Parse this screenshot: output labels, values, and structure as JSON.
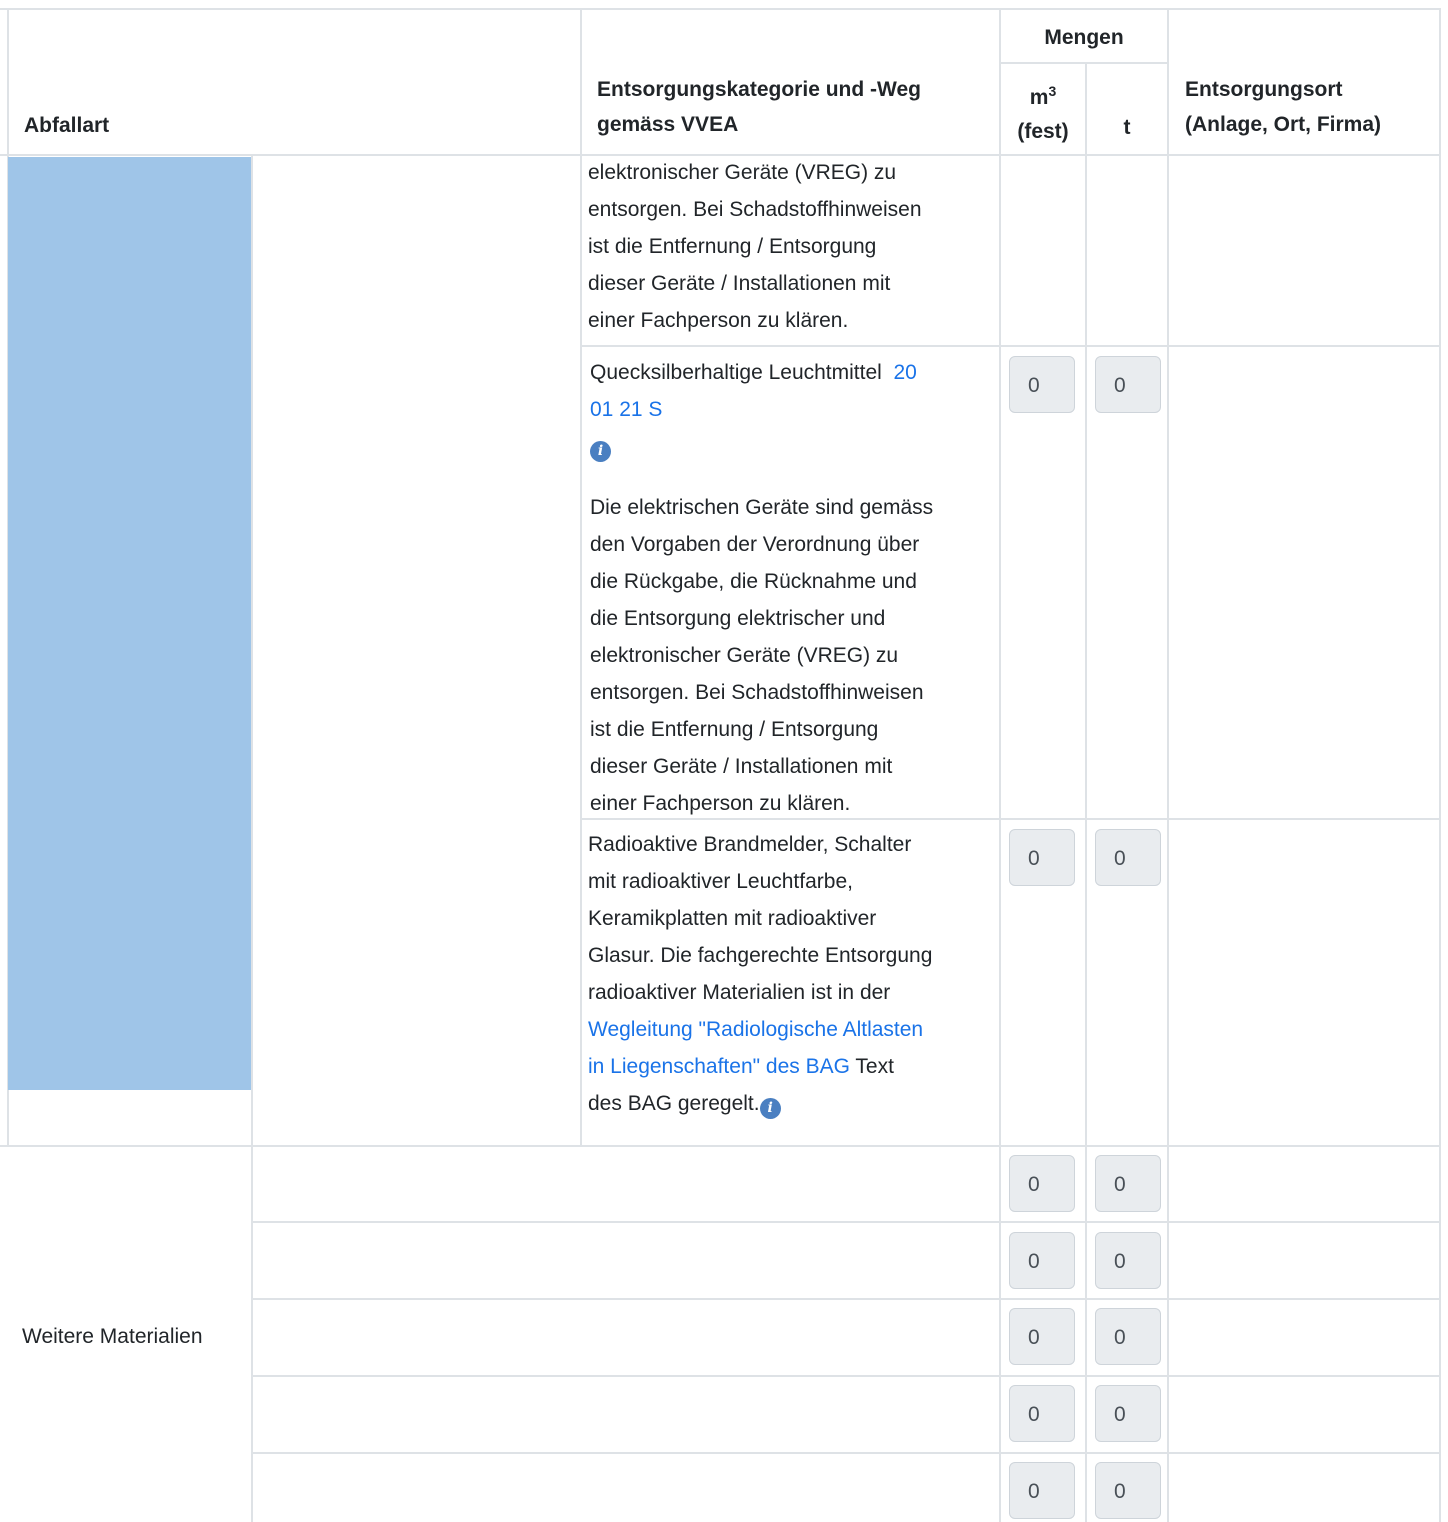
{
  "header": {
    "abfallart": "Abfallart",
    "kategorie_line1": "Entsorgungskategorie und -Weg",
    "kategorie_line2": "gemäss VVEA",
    "mengen": "Mengen",
    "m3_base": "m",
    "m3_exp": "3",
    "m3_sub": "(fest)",
    "t": "t",
    "ort_line1": "Entsorgungsort",
    "ort_line2": "(Anlage, Ort, Firma)"
  },
  "rows": {
    "cont_text": [
      "elektronischer Geräte (VREG) zu",
      "entsorgen. Bei Schadstoffhinweisen",
      "ist die Entfernung / Entsorgung",
      "dieser Geräte / Installationen mit",
      "einer Fachperson zu klären."
    ],
    "quecksilber": {
      "title": "Quecksilberhaltige Leuchtmittel",
      "code_line1": "20",
      "code_line2": "01 21 S",
      "description": [
        "Die elektrischen Geräte sind gemäss",
        "den Vorgaben der Verordnung über",
        "die Rückgabe, die Rücknahme und",
        "die Entsorgung elektrischer und",
        "elektronischer Geräte (VREG) zu",
        "entsorgen. Bei Schadstoffhinweisen",
        "ist die Entfernung / Entsorgung",
        "dieser Geräte / Installationen mit",
        "einer Fachperson zu klären."
      ],
      "m3": "0",
      "t": "0"
    },
    "radioaktiv": {
      "lines": [
        "Radioaktive Brandmelder, Schalter",
        "mit radioaktiver Leuchtfarbe,",
        "Keramikplatten mit radioaktiver",
        "Glasur. Die fachgerechte Entsorgung",
        "radioaktiver Materialien ist in der"
      ],
      "link_line1": "Wegleitung \"Radiologische Altlasten",
      "link_line2": "in Liegenschaften\" des BAG",
      "after_link": " Text",
      "last_line": "des BAG geregelt.",
      "m3": "0",
      "t": "0"
    }
  },
  "weitere": {
    "label": "Weitere Materialien",
    "rows": [
      {
        "m3": "0",
        "t": "0"
      },
      {
        "m3": "0",
        "t": "0"
      },
      {
        "m3": "0",
        "t": "0"
      },
      {
        "m3": "0",
        "t": "0"
      },
      {
        "m3": "0",
        "t": "0"
      }
    ]
  },
  "colors": {
    "blue_bar": "#9fc5e8",
    "link": "#1a73e8",
    "info_icon": "#4a7fc1",
    "border": "#dee2e6",
    "input_bg": "#e9ecef"
  },
  "icons": [
    "info-icon"
  ]
}
